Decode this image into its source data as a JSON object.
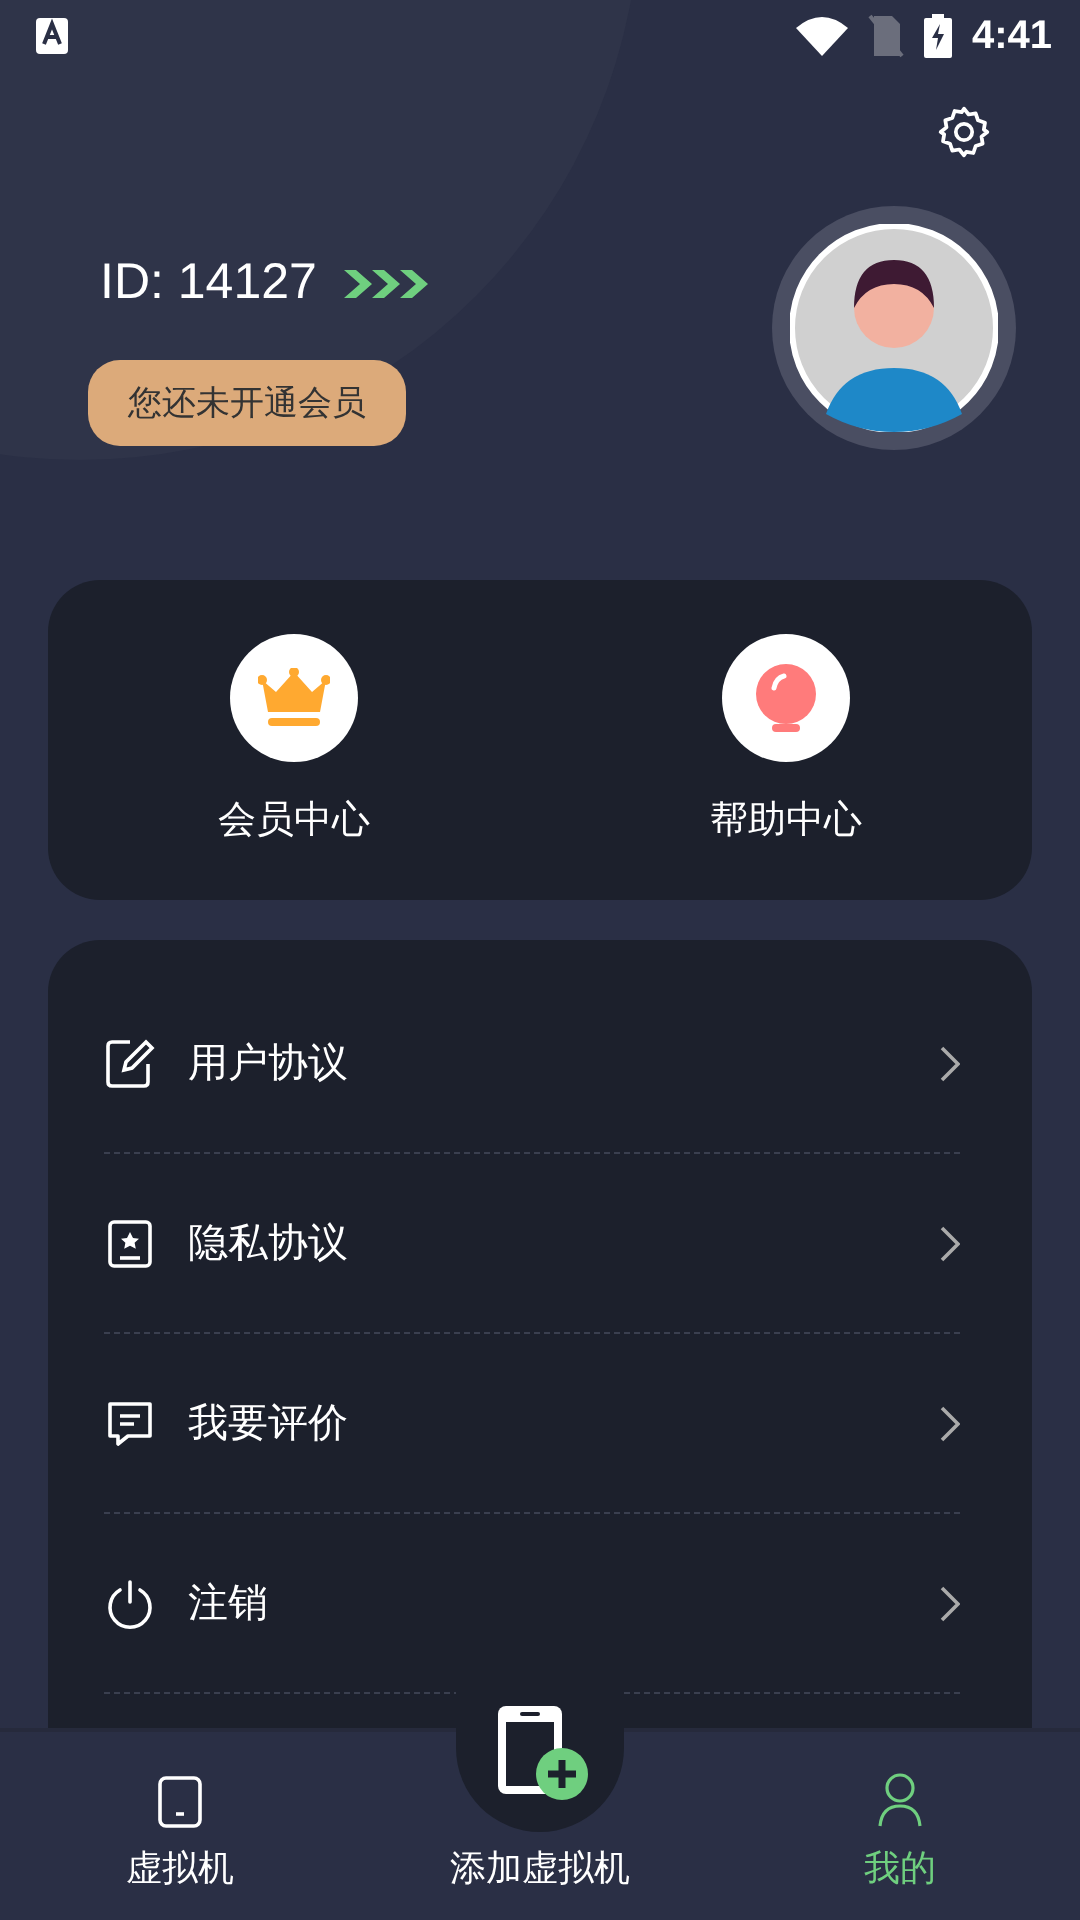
{
  "status_bar": {
    "time": "4:41"
  },
  "profile": {
    "id_text": "ID: 14127",
    "membership": "您还未开通会员"
  },
  "shortcuts": [
    {
      "kind": "crown",
      "label": "会员中心"
    },
    {
      "kind": "bulb",
      "label": "帮助中心"
    }
  ],
  "menu": [
    {
      "kind": "agreement",
      "label": "用户协议"
    },
    {
      "kind": "privacy",
      "label": "隐私协议"
    },
    {
      "kind": "review",
      "label": "我要评价"
    },
    {
      "kind": "logout",
      "label": "注销"
    }
  ],
  "tabs": [
    {
      "kind": "device",
      "label": "虚拟机",
      "selected": false
    },
    {
      "kind": "add",
      "label": "添加虚拟机",
      "selected": false
    },
    {
      "kind": "me",
      "label": "我的",
      "selected": true
    }
  ]
}
